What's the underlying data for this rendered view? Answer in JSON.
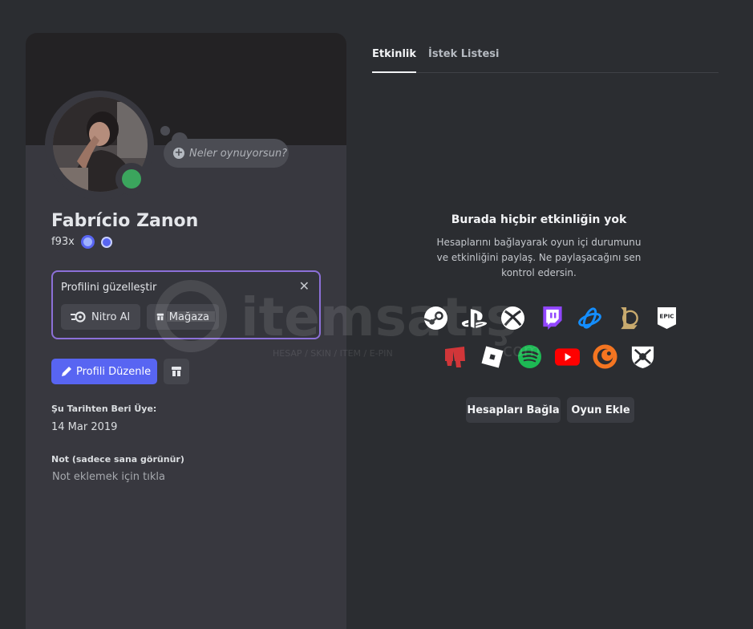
{
  "profile": {
    "display_name": "Fabrício Zanon",
    "username": "f93x",
    "activity_placeholder": "Neler oynuyorsun?",
    "status_color": "#3ba55d"
  },
  "beautify": {
    "title": "Profilini güzelleştir",
    "nitro_label": "Nitro Al",
    "shop_label": "Mağaza"
  },
  "actions": {
    "edit_profile": "Profili Düzenle"
  },
  "member": {
    "label": "Şu Tarihten Beri Üye:",
    "date": "14 Mar 2019"
  },
  "note": {
    "label": "Not (sadece sana görünür)",
    "placeholder": "Not eklemek için tıkla"
  },
  "tabs": [
    {
      "label": "Etkinlik",
      "active": true
    },
    {
      "label": "İstek Listesi",
      "active": false
    }
  ],
  "empty_state": {
    "title": "Burada hiçbir etkinliğin yok",
    "description": "Hesaplarını bağlayarak oyun içi durumunu ve etkinliğini paylaş. Ne paylaşacağını sen kontrol edersin.",
    "connect_button": "Hesapları Bağla",
    "add_game_button": "Oyun Ekle"
  },
  "platforms_row1": [
    "steam-icon",
    "playstation-icon",
    "xbox-icon",
    "twitch-icon",
    "battlenet-icon",
    "league-of-legends-icon",
    "epic-games-icon"
  ],
  "platforms_row2": [
    "riot-games-icon",
    "roblox-icon",
    "spotify-icon",
    "youtube-icon",
    "crunchyroll-icon",
    "bungie-icon"
  ],
  "epic_label": "EPIC",
  "watermark": {
    "brand": "itemsatış",
    "tagline": "HESAP / SKIN / ITEM / E-PIN",
    "suffix": ".com"
  },
  "colors": {
    "accent": "#5865f2",
    "beautify_border": "#8c70d8",
    "spotify": "#1db954",
    "youtube": "#ff0000",
    "twitch": "#9146ff",
    "crunchyroll": "#f47521",
    "riot": "#d13639",
    "battlenet": "#148eff",
    "lol": "#c8aa6e"
  }
}
